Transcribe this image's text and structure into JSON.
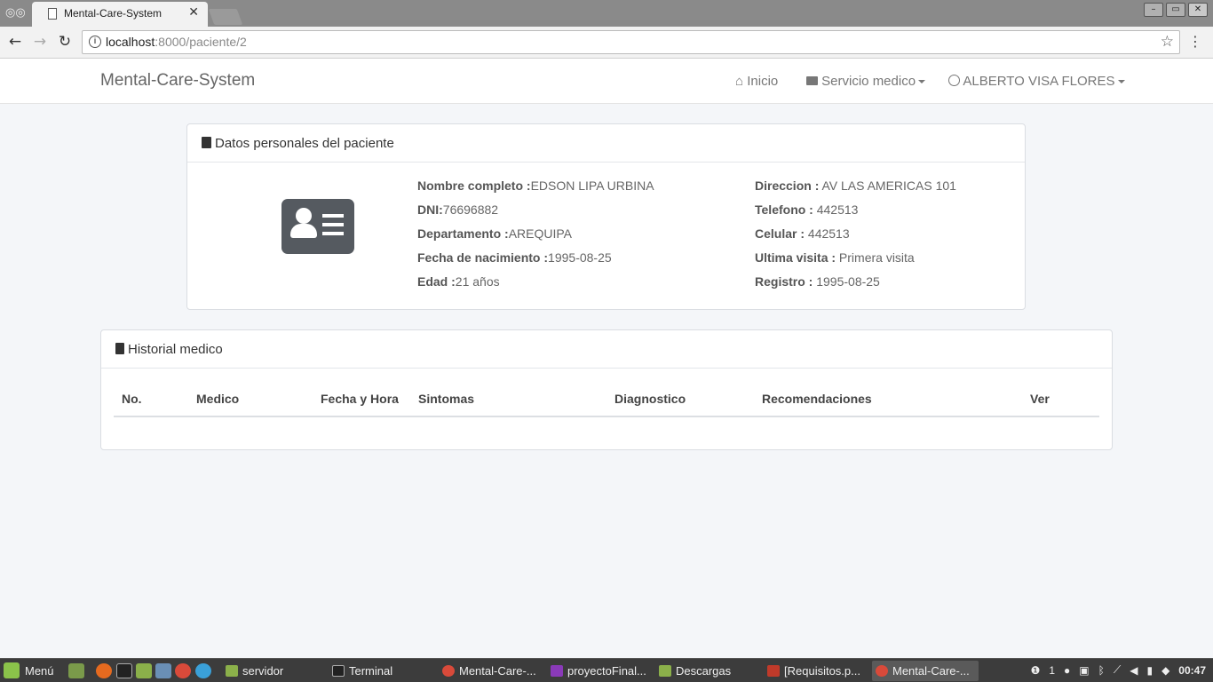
{
  "browser": {
    "tab_title": "Mental-Care-System",
    "url_host": "localhost",
    "url_path": ":8000/paciente/2"
  },
  "navbar": {
    "brand": "Mental-Care-System",
    "inicio": "Inicio",
    "servicio": "Servicio medico",
    "user": "ALBERTO VISA FLORES"
  },
  "personal": {
    "heading": "Datos personales del paciente",
    "left": [
      {
        "label": "Nombre completo :",
        "value": "EDSON LIPA URBINA"
      },
      {
        "label": "DNI:",
        "value": "76696882"
      },
      {
        "label": "Departamento :",
        "value": "AREQUIPA"
      },
      {
        "label": "Fecha de nacimiento :",
        "value": "1995-08-25"
      },
      {
        "label": "Edad :",
        "value": "21 años"
      }
    ],
    "right": [
      {
        "label": "Direccion :",
        "value": " AV LAS AMERICAS 101"
      },
      {
        "label": "Telefono :",
        "value": " 442513"
      },
      {
        "label": "Celular :",
        "value": " 442513"
      },
      {
        "label": "Ultima visita :",
        "value": " Primera visita"
      },
      {
        "label": "Registro :",
        "value": " 1995-08-25"
      }
    ]
  },
  "history": {
    "heading": "Historial medico",
    "columns": [
      "No.",
      "Medico",
      "Fecha y Hora",
      "Sintomas",
      "Diagnostico",
      "Recomendaciones",
      "Ver"
    ]
  },
  "taskbar": {
    "menu": "Menú",
    "tasks": [
      "servidor",
      "Terminal",
      "Mental-Care-...",
      "proyectoFinal...",
      "Descargas",
      "[Requisitos.p...",
      "Mental-Care-..."
    ],
    "tray_count": "1",
    "clock": "00:47"
  }
}
